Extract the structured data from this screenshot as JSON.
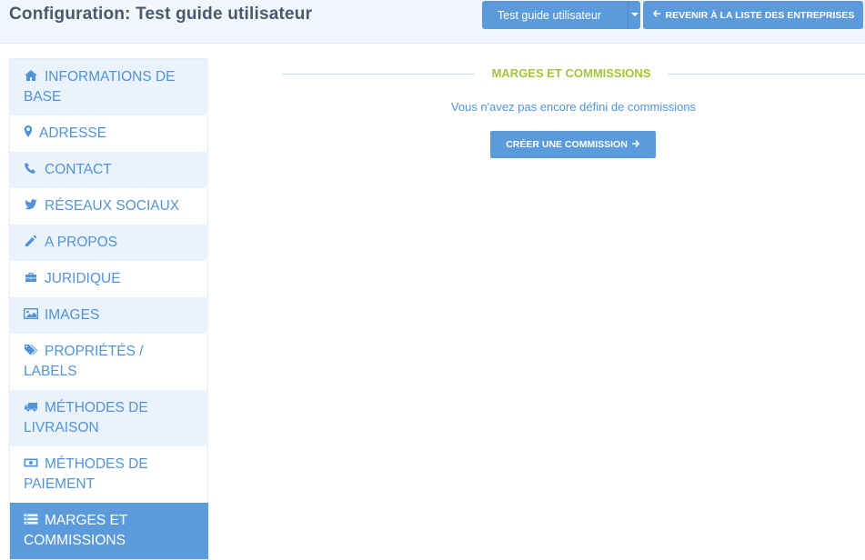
{
  "header": {
    "title": "Configuration: Test guide utilisateur",
    "company_select": {
      "selected": "Test guide utilisateur"
    },
    "back_button": {
      "label": "REVENIR À LA LISTE DES ENTREPRISES",
      "icon": "arrow-left-icon"
    }
  },
  "sidebar": {
    "items": [
      {
        "label": "INFORMATIONS DE BASE",
        "icon": "home-icon"
      },
      {
        "label": "ADRESSE",
        "icon": "map-marker-icon"
      },
      {
        "label": "CONTACT",
        "icon": "phone-icon"
      },
      {
        "label": "RÉSEAUX SOCIAUX",
        "icon": "twitter-icon"
      },
      {
        "label": "A PROPOS",
        "icon": "pencil-icon"
      },
      {
        "label": "JURIDIQUE",
        "icon": "briefcase-icon"
      },
      {
        "label": "IMAGES",
        "icon": "image-icon"
      },
      {
        "label": "PROPRIÉTÉS / LABELS",
        "icon": "tags-icon"
      },
      {
        "label": "MÉTHODES DE LIVRAISON",
        "icon": "truck-icon"
      },
      {
        "label": "MÉTHODES DE PAIEMENT",
        "icon": "money-icon"
      },
      {
        "label": "MARGES ET COMMISSIONS",
        "icon": "list-icon",
        "active": true
      }
    ]
  },
  "main": {
    "section_title": "MARGES ET COMMISSIONS",
    "empty_message": "Vous n'avez pas encore défini de commissions",
    "create_button": {
      "label": "CRÉER UNE COMMISSION",
      "icon": "arrow-right-icon"
    }
  },
  "colors": {
    "primary": "#5b9bdc",
    "link_text": "#5194d6",
    "accent_title": "#a3c43b",
    "header_bg": "#f1f6fc",
    "nav_alt_bg": "#eaf2fb"
  }
}
